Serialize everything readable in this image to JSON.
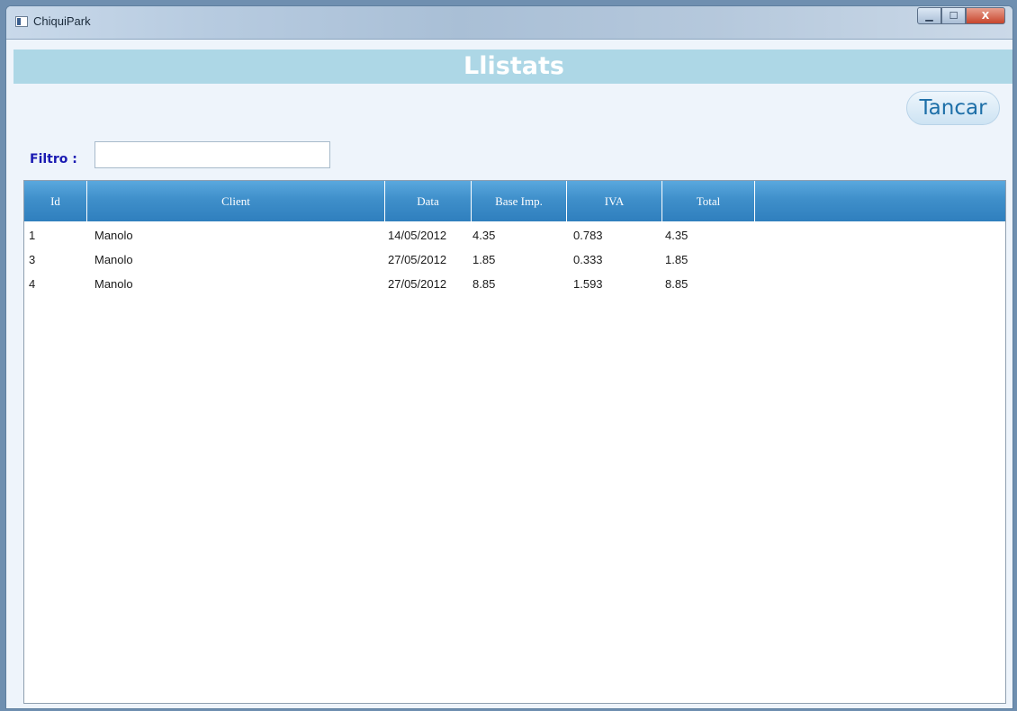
{
  "window": {
    "title": "ChiquiPark",
    "controls": {
      "minimize": "▁",
      "maximize": "☐",
      "close": "X"
    }
  },
  "header": {
    "title": "Llistats"
  },
  "toolbar": {
    "close_label": "Tancar"
  },
  "filter": {
    "label": "Filtro :",
    "value": "",
    "placeholder": ""
  },
  "table": {
    "columns": [
      "Id",
      "Client",
      "Data",
      "Base Imp.",
      "IVA",
      "Total"
    ],
    "rows": [
      [
        "1",
        "Manolo",
        "14/05/2012",
        "4.35",
        "0.783",
        "4.35"
      ],
      [
        "3",
        "Manolo",
        "27/05/2012",
        "1.85",
        "0.333",
        "1.85"
      ],
      [
        "4",
        "Manolo",
        "27/05/2012",
        "8.85",
        "1.593",
        "8.85"
      ]
    ]
  },
  "colors": {
    "header_bar": "#add7e6",
    "grid_header": "#3f8fca",
    "filter_label": "#1a1ab2",
    "button_text": "#1d6fa8"
  }
}
